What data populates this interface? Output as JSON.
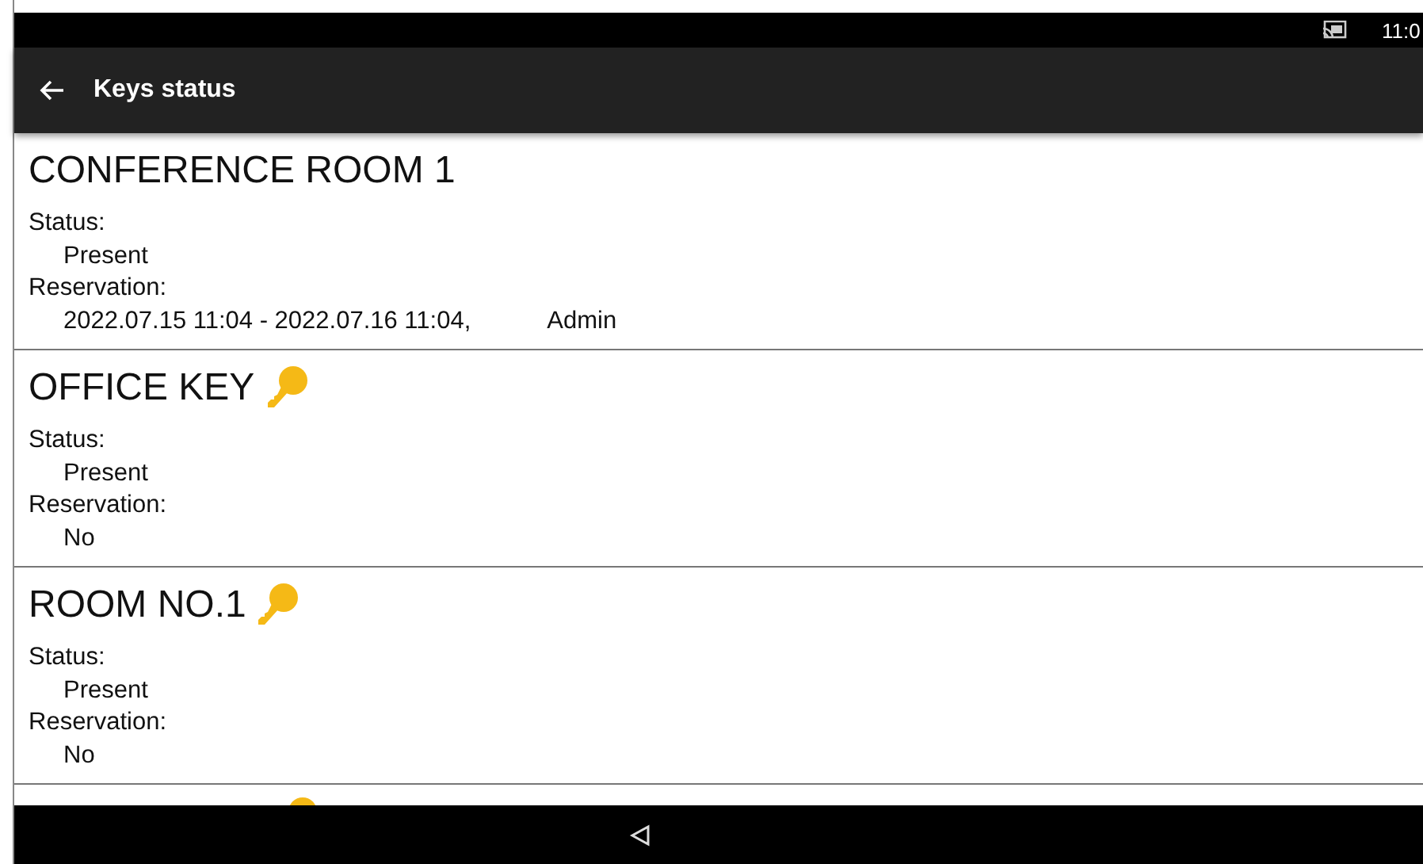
{
  "status_bar": {
    "time": "11:0"
  },
  "app_bar": {
    "title": "Keys status"
  },
  "keys": [
    {
      "name": "CONFERENCE ROOM 1",
      "has_key": false,
      "status_label": "Status:",
      "status": "Present",
      "reservation_label": "Reservation:",
      "reservation": "2022.07.15 11:04 - 2022.07.16 11:04,",
      "reserved_by": "Admin"
    },
    {
      "name": "OFFICE KEY",
      "has_key": true,
      "status_label": "Status:",
      "status": "Present",
      "reservation_label": "Reservation:",
      "reservation": "No"
    },
    {
      "name": "ROOM NO.1",
      "has_key": true,
      "status_label": "Status:",
      "status": "Present",
      "reservation_label": "Reservation:",
      "reservation": "No"
    },
    {
      "has_key": true
    }
  ]
}
